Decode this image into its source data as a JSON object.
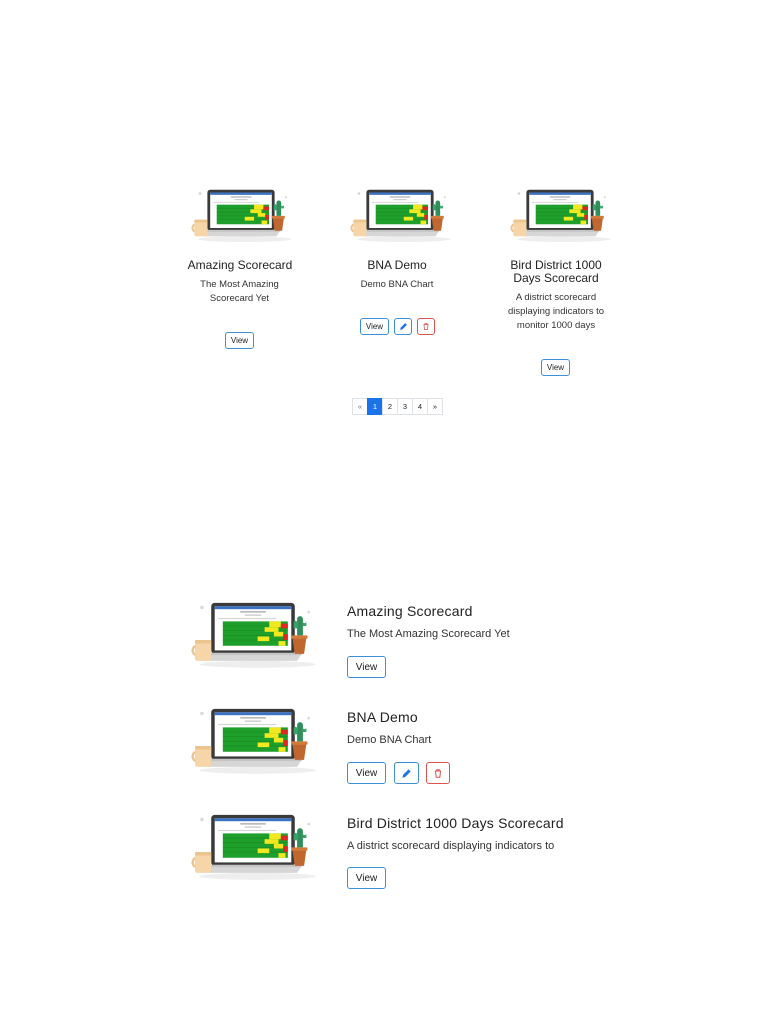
{
  "pagination": {
    "prev": "«",
    "next": "»",
    "pages": [
      "1",
      "2",
      "3",
      "4"
    ],
    "active": "1"
  },
  "scorecards": [
    {
      "title": "Amazing Scorecard",
      "description": "The Most Amazing Scorecard Yet",
      "view_label": "View",
      "editable": false
    },
    {
      "title": "BNA Demo",
      "description": "Demo BNA Chart",
      "view_label": "View",
      "editable": true
    },
    {
      "title": "Bird District 1000 Days Scorecard",
      "description": "A district scorecard displaying indicators to monitor 1000 days",
      "view_label": "View",
      "editable": false
    }
  ],
  "list_view": {
    "descriptions": [
      "The Most Amazing Scorecard Yet",
      "Demo BNA Chart",
      "A district scorecard displaying indicators to"
    ]
  },
  "icons": {
    "thumbnail": "scorecard-laptop-illustration",
    "edit": "pencil-icon",
    "delete": "trash-icon"
  },
  "colors": {
    "primary": "#1a73e8",
    "button_border": "#3d8fd6",
    "danger": "#d9534f",
    "cell_green": "#1e9e2a",
    "cell_yellow": "#f2e81f",
    "cell_red": "#e0281e"
  }
}
